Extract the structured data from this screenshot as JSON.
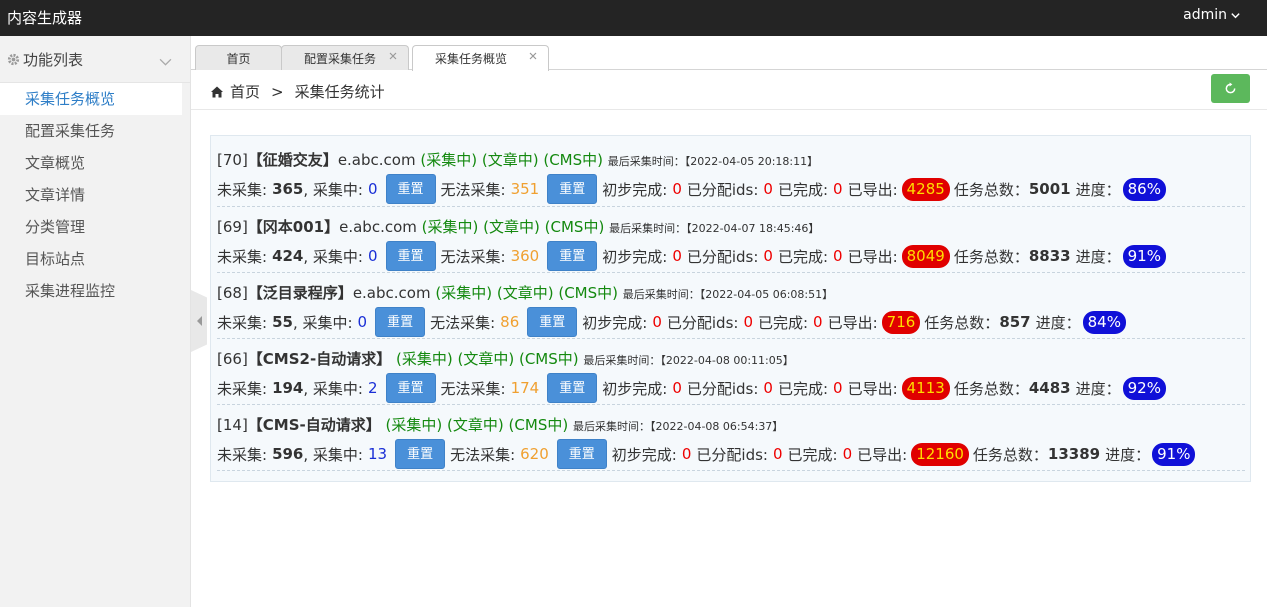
{
  "topbar": {
    "title": "内容生成器",
    "user": "admin"
  },
  "sidebar": {
    "header": "功能列表",
    "items": [
      "采集任务概览",
      "配置采集任务",
      "文章概览",
      "文章详情",
      "分类管理",
      "目标站点",
      "采集进程监控"
    ]
  },
  "tabs": [
    "首页",
    "配置采集任务",
    "采集任务概览"
  ],
  "breadcrumb": {
    "home": "首页",
    "sep": ">",
    "current": "采集任务统计"
  },
  "labels": {
    "uncollected": "未采集:",
    "collecting": ", 采集中:",
    "reset": "重置",
    "cannot": "无法采集:",
    "initial": "初步完成:",
    "assigned": "已分配ids:",
    "done": "已完成:",
    "exported": "已导出:",
    "total": "任务总数：",
    "progress": "进度：",
    "lasttime": "最后采集时间：",
    "st1": "(采集中)",
    "st2": "(文章中)",
    "st3": "(CMS中)"
  },
  "tasks": [
    {
      "id": "[70]",
      "name": "【征婚交友】",
      "domain": "e.abc.com",
      "time": "【2022-04-05 20:18:11】",
      "uncollected": "365",
      "collecting": "0",
      "cannot": "351",
      "initial": "0",
      "assigned": "0",
      "done": "0",
      "exported": "4285",
      "total": "5001",
      "progress": "86%"
    },
    {
      "id": "[69]",
      "name": "【冈本001】",
      "domain": "e.abc.com",
      "time": "【2022-04-07 18:45:46】",
      "uncollected": "424",
      "collecting": "0",
      "cannot": "360",
      "initial": "0",
      "assigned": "0",
      "done": "0",
      "exported": "8049",
      "total": "8833",
      "progress": "91%"
    },
    {
      "id": "[68]",
      "name": "【泛目录程序】",
      "domain": "e.abc.com",
      "time": "【2022-04-05 06:08:51】",
      "uncollected": "55",
      "collecting": "0",
      "cannot": "86",
      "initial": "0",
      "assigned": "0",
      "done": "0",
      "exported": "716",
      "total": "857",
      "progress": "84%"
    },
    {
      "id": "[66]",
      "name": "【CMS2-自动请求】",
      "domain": "",
      "time": "【2022-04-08 00:11:05】",
      "uncollected": "194",
      "collecting": "2",
      "cannot": "174",
      "initial": "0",
      "assigned": "0",
      "done": "0",
      "exported": "4113",
      "total": "4483",
      "progress": "92%"
    },
    {
      "id": "[14]",
      "name": "【CMS-自动请求】",
      "domain": "",
      "time": "【2022-04-08 06:54:37】",
      "uncollected": "596",
      "collecting": "13",
      "cannot": "620",
      "initial": "0",
      "assigned": "0",
      "done": "0",
      "exported": "12160",
      "total": "13389",
      "progress": "91%"
    }
  ]
}
